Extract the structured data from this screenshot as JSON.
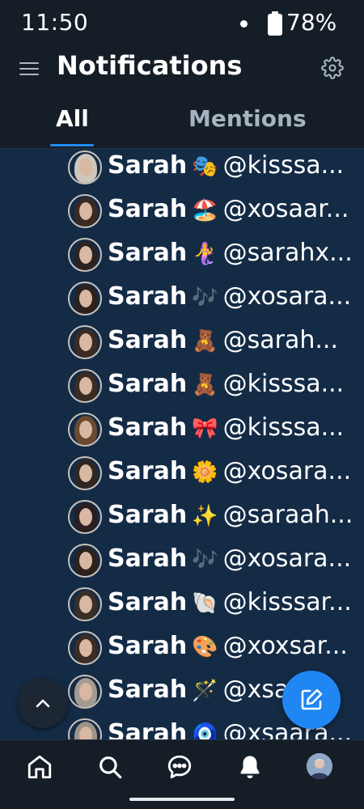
{
  "status": {
    "time": "11:50",
    "battery": "78%"
  },
  "header": {
    "title": "Notifications"
  },
  "tabs": [
    {
      "label": "All",
      "selected": true
    },
    {
      "label": "Mentions",
      "selected": false
    }
  ],
  "rows": [
    {
      "name": "Sarah",
      "emoji": "🎭",
      "handle": "@kisssa...",
      "hair": "#cfc7bd"
    },
    {
      "name": "Sarah",
      "emoji": "🏖️",
      "handle": "@xosaar...",
      "hair": "#3a2a22"
    },
    {
      "name": "Sarah",
      "emoji": "🧜‍♀️",
      "handle": "@sarahx...",
      "hair": "#2b2221"
    },
    {
      "name": "Sarah",
      "emoji": "🎶",
      "handle": "@xosara...",
      "hair": "#2c211c"
    },
    {
      "name": "Sarah",
      "emoji": "🧸",
      "handle": "@sarah...",
      "hair": "#3b2b22"
    },
    {
      "name": "Sarah",
      "emoji": "🧸",
      "handle": "@kisssa...",
      "hair": "#3b2b22"
    },
    {
      "name": "Sarah",
      "emoji": "🎀",
      "handle": "@kisssa...",
      "hair": "#6b4a2f"
    },
    {
      "name": "Sarah",
      "emoji": "🌼",
      "handle": "@xosara...",
      "hair": "#2f2624"
    },
    {
      "name": "Sarah",
      "emoji": "✨",
      "handle": "@saraah...",
      "hair": "#2a1e23"
    },
    {
      "name": "Sarah",
      "emoji": "🎶",
      "handle": "@xosara...",
      "hair": "#2c211c"
    },
    {
      "name": "Sarah",
      "emoji": "🐚",
      "handle": "@kisssar...",
      "hair": "#3a2e28"
    },
    {
      "name": "Sarah",
      "emoji": "🎨",
      "handle": "@xoxsar...",
      "hair": "#3b2c25"
    },
    {
      "name": "Sarah",
      "emoji": "🪄",
      "handle": "@xsa...",
      "hair": "#a39b92"
    },
    {
      "name": "Sarah",
      "emoji": "🧿",
      "handle": "@xsaara...",
      "hair": "#9d9388"
    }
  ],
  "icons": {
    "menu": "menu-icon",
    "settings": "gear-icon",
    "scroll_top": "chevron-up-icon",
    "compose": "compose-icon",
    "nav": [
      "home-icon",
      "search-icon",
      "chat-icon",
      "bell-icon",
      "profile-avatar"
    ]
  },
  "colors": {
    "accent": "#1f86f2",
    "header_bg": "#151d27",
    "list_bg": "#142b46",
    "tab_inactive": "#a6b3c1"
  }
}
